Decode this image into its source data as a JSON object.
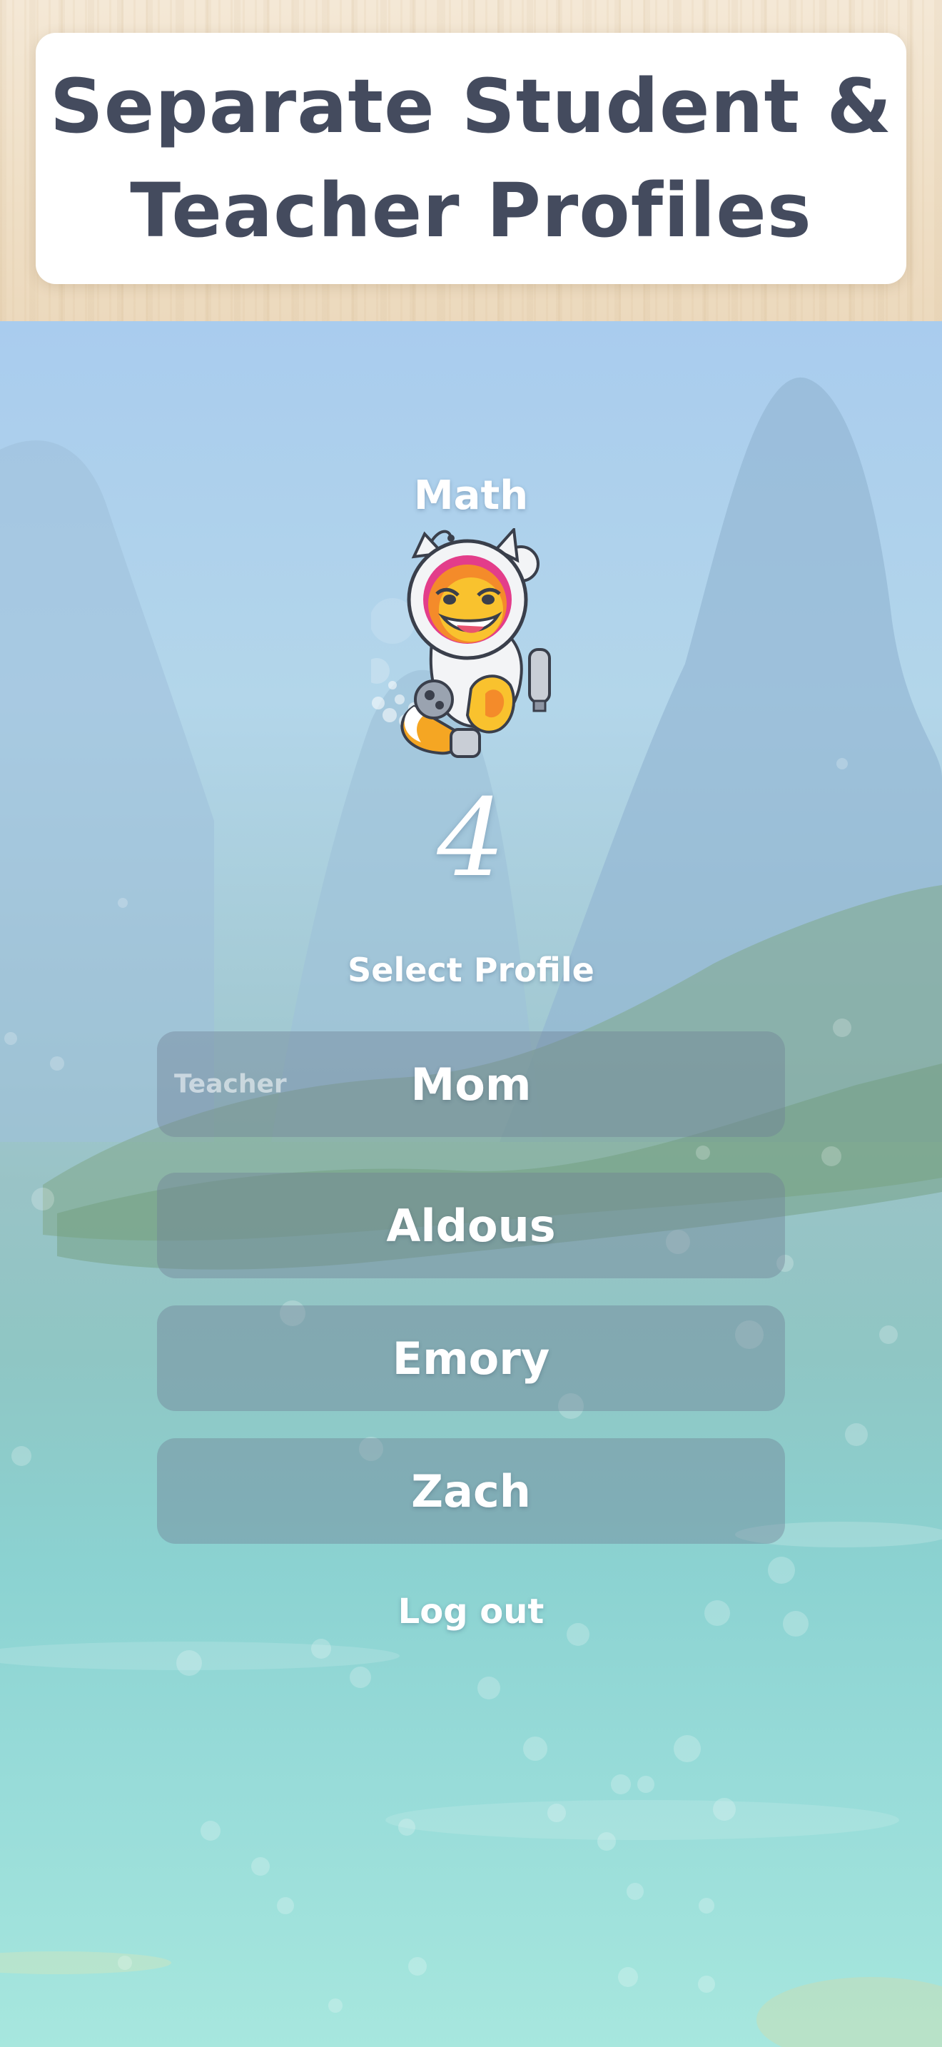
{
  "banner": {
    "title_line1": "Separate Student &",
    "title_line2": "Teacher Profiles"
  },
  "app": {
    "subject": "Math",
    "grade": "4",
    "mascot_icon": "astronaut-fox-mascot-icon"
  },
  "profiles": {
    "heading": "Select Profile",
    "items": [
      {
        "name": "Mom",
        "role": "Teacher"
      },
      {
        "name": "Aldous",
        "role": ""
      },
      {
        "name": "Emory",
        "role": ""
      },
      {
        "name": "Zach",
        "role": ""
      }
    ]
  },
  "actions": {
    "logout_label": "Log out"
  },
  "colors": {
    "title_text": "#444b5e",
    "sky": "#a9ccee",
    "water": "#a7e7de",
    "button_fill": "#708096"
  }
}
